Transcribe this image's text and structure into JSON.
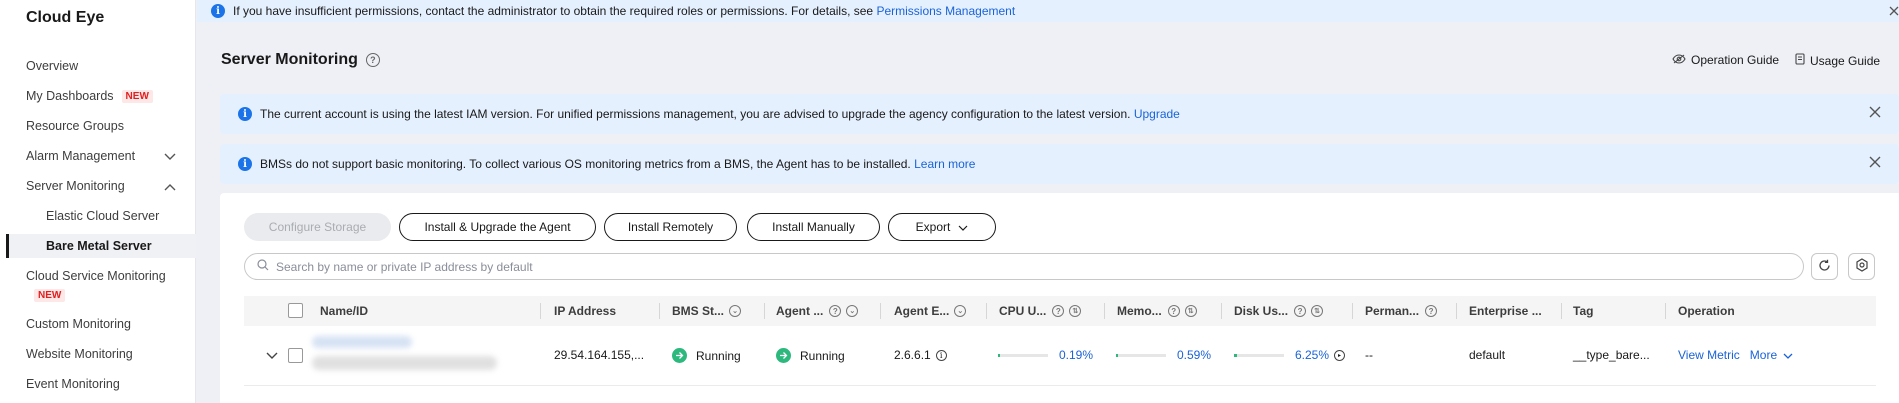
{
  "sidebar": {
    "title": "Cloud Eye",
    "items": [
      {
        "label": "Overview"
      },
      {
        "label": "My Dashboards",
        "badge": "NEW"
      },
      {
        "label": "Resource Groups"
      },
      {
        "label": "Alarm Management"
      },
      {
        "label": "Server Monitoring"
      },
      {
        "label": "Elastic Cloud Server"
      },
      {
        "label": "Bare Metal Server"
      },
      {
        "label": "Cloud Service Monitoring",
        "badge": "NEW"
      },
      {
        "label": "Custom Monitoring"
      },
      {
        "label": "Website Monitoring"
      },
      {
        "label": "Event Monitoring"
      }
    ]
  },
  "topbar": {
    "text": "If you have insufficient permissions, contact the administrator to obtain the required roles or permissions. For details, see",
    "link": "Permissions Management"
  },
  "header": {
    "title": "Server Monitoring",
    "operation_guide": "Operation Guide",
    "usage_guide": "Usage Guide"
  },
  "alerts": [
    {
      "text": "The current account is using the latest IAM version. For unified permissions management, you are advised to upgrade the agency configuration to the latest version.",
      "link": "Upgrade"
    },
    {
      "text": "BMSs do not support basic monitoring. To collect various OS monitoring metrics from a BMS, the Agent has to be installed.",
      "link": "Learn more"
    }
  ],
  "toolbar": {
    "configure_storage": "Configure Storage",
    "install_upgrade": "Install & Upgrade the Agent",
    "install_remotely": "Install Remotely",
    "install_manually": "Install Manually",
    "export": "Export"
  },
  "search": {
    "placeholder": "Search by name or private IP address by default"
  },
  "table": {
    "columns": [
      "Name/ID",
      "IP Address",
      "BMS St...",
      "Agent ...",
      "Agent E...",
      "CPU U...",
      "Memo...",
      "Disk Us...",
      "Perman...",
      "Enterprise ...",
      "Tag",
      "Operation"
    ],
    "rows": [
      {
        "ip": "29.54.164.155,...",
        "bms_status": "Running",
        "agent_status": "Running",
        "agent_version": "2.6.6.1",
        "cpu": "0.19%",
        "cpu_value": 0.19,
        "memory": "0.59%",
        "memory_value": 0.59,
        "disk": "6.25%",
        "disk_value": 6.25,
        "permanent": "--",
        "enterprise_project": "default",
        "tag": "__type_bare...",
        "view_metric": "View Metric",
        "more": "More"
      }
    ]
  },
  "colors": {
    "accent": "#1a63d6",
    "success": "#2db87d",
    "info_bg": "#e5f0ff"
  }
}
